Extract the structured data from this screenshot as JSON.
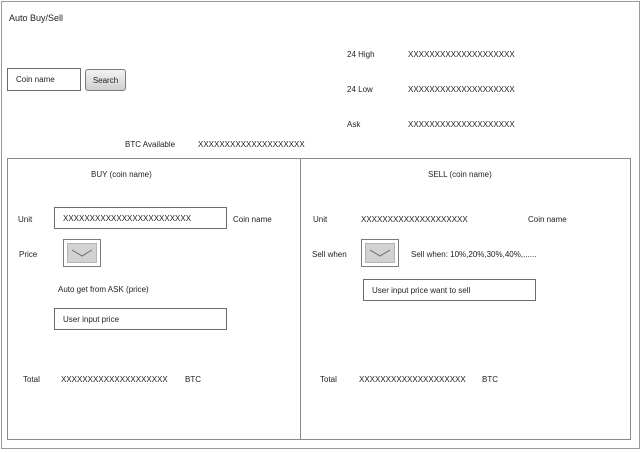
{
  "app": {
    "title": "Auto Buy/Sell"
  },
  "search": {
    "placeholder_value": "Coin name",
    "button_label": "Search"
  },
  "stats": {
    "high_label": "24 High",
    "high_value": "XXXXXXXXXXXXXXXXXXXX",
    "low_label": "24 Low",
    "low_value": "XXXXXXXXXXXXXXXXXXXX",
    "ask_label": "Ask",
    "ask_value": "XXXXXXXXXXXXXXXXXXXX"
  },
  "btc_available": {
    "label": "BTC Available",
    "value": "XXXXXXXXXXXXXXXXXXXX"
  },
  "buy": {
    "heading": "BUY (coin name)",
    "unit_label": "Unit",
    "unit_value": "XXXXXXXXXXXXXXXXXXXXXXXX",
    "unit_suffix": "Coin name",
    "price_label": "Price",
    "auto_text": "Auto get from ASK (price)",
    "price_input": "User input price",
    "total_label": "Total",
    "total_value": "XXXXXXXXXXXXXXXXXXXX",
    "total_unit": "BTC"
  },
  "sell": {
    "heading": "SELL  (coin name)",
    "unit_label": "Unit",
    "unit_value": "XXXXXXXXXXXXXXXXXXXX",
    "unit_suffix": "Coin name",
    "sell_when_label": "Sell when",
    "sell_when_options": "Sell when: 10%,20%,30%,40%,......",
    "price_input": "User input price want to sell",
    "total_label": "Total",
    "total_value": "XXXXXXXXXXXXXXXXXXXX",
    "total_unit": "BTC"
  },
  "icons": {
    "dropdown": "chevron-down-icon"
  }
}
